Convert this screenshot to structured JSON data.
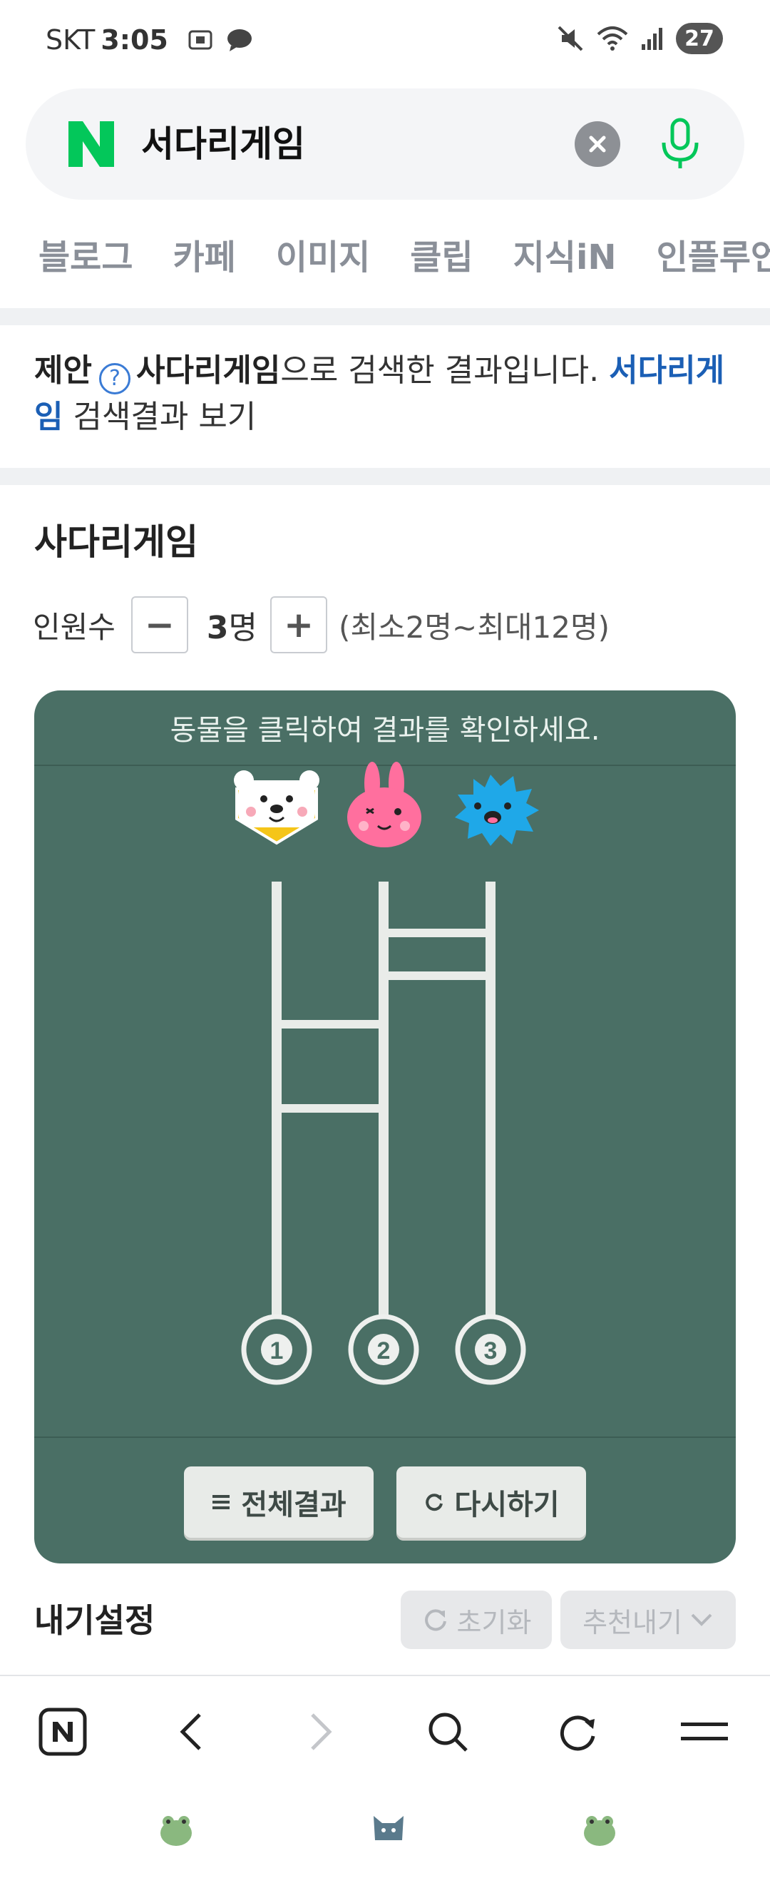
{
  "status_bar": {
    "carrier": "SKT",
    "time": "3:05",
    "battery": "27"
  },
  "search": {
    "query": "서다리게임"
  },
  "tabs": [
    "블로그",
    "카페",
    "이미지",
    "클립",
    "지식iN",
    "인플루언"
  ],
  "suggestion": {
    "prefix": "제안",
    "suggested_term": "사다리게임",
    "middle": "으로 검색한 결과입니다.",
    "original_link": "서다리게임",
    "suffix": " 검색결과 보기"
  },
  "game": {
    "title": "사다리게임",
    "count_label": "인원수",
    "decrement": "−",
    "increment": "+",
    "count_value": "3",
    "count_unit": "명",
    "count_range": "(최소2명~최대12명)",
    "instruction": "동물을 클릭하여 결과를 확인하세요.",
    "players": [
      {
        "name": "bear",
        "icon": "bear-icon"
      },
      {
        "name": "rabbit",
        "icon": "rabbit-icon"
      },
      {
        "name": "hedgehog",
        "icon": "hedgehog-icon"
      }
    ],
    "results": [
      "1",
      "2",
      "3"
    ],
    "full_result_label": "전체결과",
    "retry_label": "다시하기"
  },
  "settings": {
    "title": "내기설정",
    "reset_label": "초기화",
    "recommend_label": "추천내기"
  },
  "colors": {
    "board": "#4a6f65",
    "naver_green": "#03c75a",
    "link_blue": "#1b5fb5"
  }
}
